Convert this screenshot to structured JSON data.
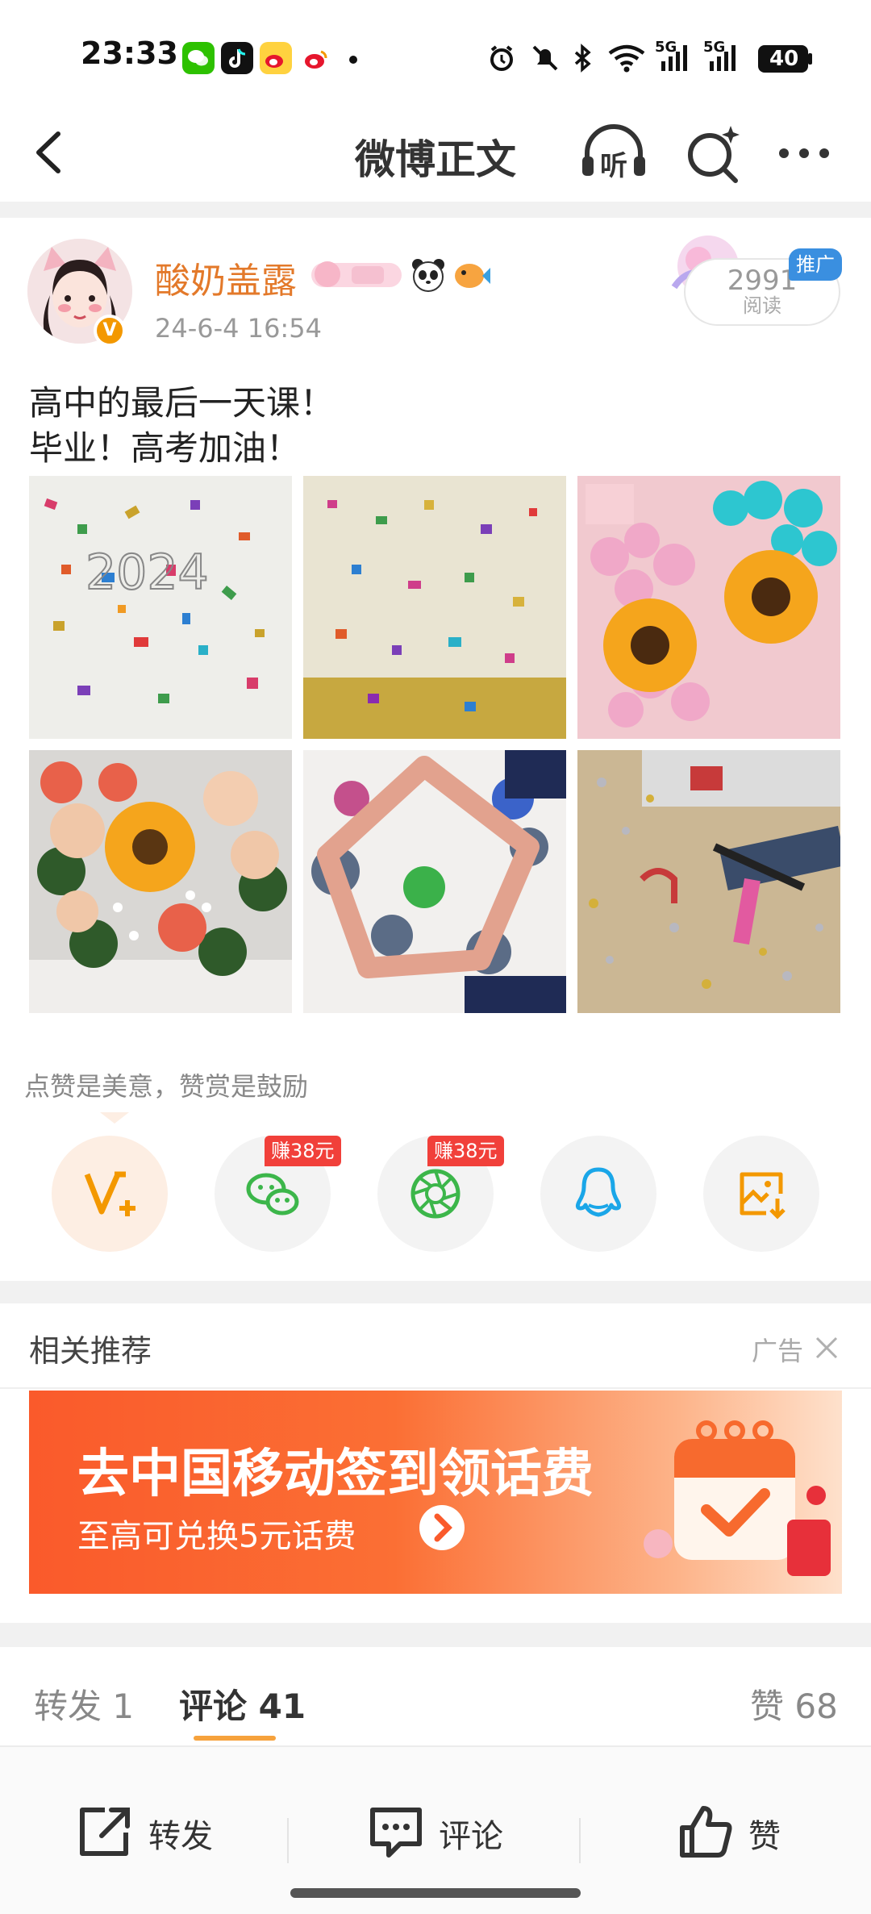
{
  "status_bar": {
    "time": "23:33",
    "battery": "40",
    "network_1": "5G",
    "network_2": "5G",
    "icons": [
      "wechat-icon",
      "tiktok-icon",
      "weibo-icon",
      "weibo-lite-icon",
      "dot-icon",
      "alarm-icon",
      "mute-icon",
      "bluetooth-icon",
      "wifi-icon",
      "signal-icon",
      "signal-icon",
      "battery-icon"
    ]
  },
  "nav": {
    "title": "微博正文",
    "listen_label": "听",
    "icons": [
      "back-icon",
      "listen-icon",
      "search-sparkle-icon",
      "more-icon"
    ]
  },
  "post": {
    "username": "酸奶盖露",
    "timestamp": "24-6-4 16:54",
    "read_count": "2991",
    "read_label": "阅读",
    "promo_label": "推广",
    "text_line1": "高中的最后一天课！",
    "text_line2": "毕业！高考加油！",
    "images": [
      "confetti-poster-photo",
      "confetti-paper-photo",
      "sunflower-bouquet-photo",
      "rose-sunflower-bouquet-photo",
      "handprint-hands-photo",
      "desk-confetti-photo"
    ]
  },
  "reward": {
    "tip": "点赞是美意，赞赏是鼓励",
    "share_buttons": [
      {
        "name": "vplus-reward",
        "badge": ""
      },
      {
        "name": "wechat-share",
        "badge": "赚38元"
      },
      {
        "name": "moments-share",
        "badge": "赚38元"
      },
      {
        "name": "qq-share",
        "badge": ""
      },
      {
        "name": "save-image",
        "badge": ""
      }
    ]
  },
  "related": {
    "title": "相关推荐",
    "ad_label": "广告",
    "banner_headline": "去中国移动签到领话费",
    "banner_sub": "至高可兑换5元话费"
  },
  "tabs": {
    "repost": "转发 1",
    "comments": "评论 41",
    "likes": "赞 68"
  },
  "bottom_bar": {
    "repost": "转发",
    "comment": "评论",
    "like": "赞"
  },
  "colors": {
    "accent_orange": "#e3792a",
    "earn_red": "#f1403a",
    "promo_blue": "#3a8fe0",
    "banner_orange": "#fa5a2b"
  }
}
